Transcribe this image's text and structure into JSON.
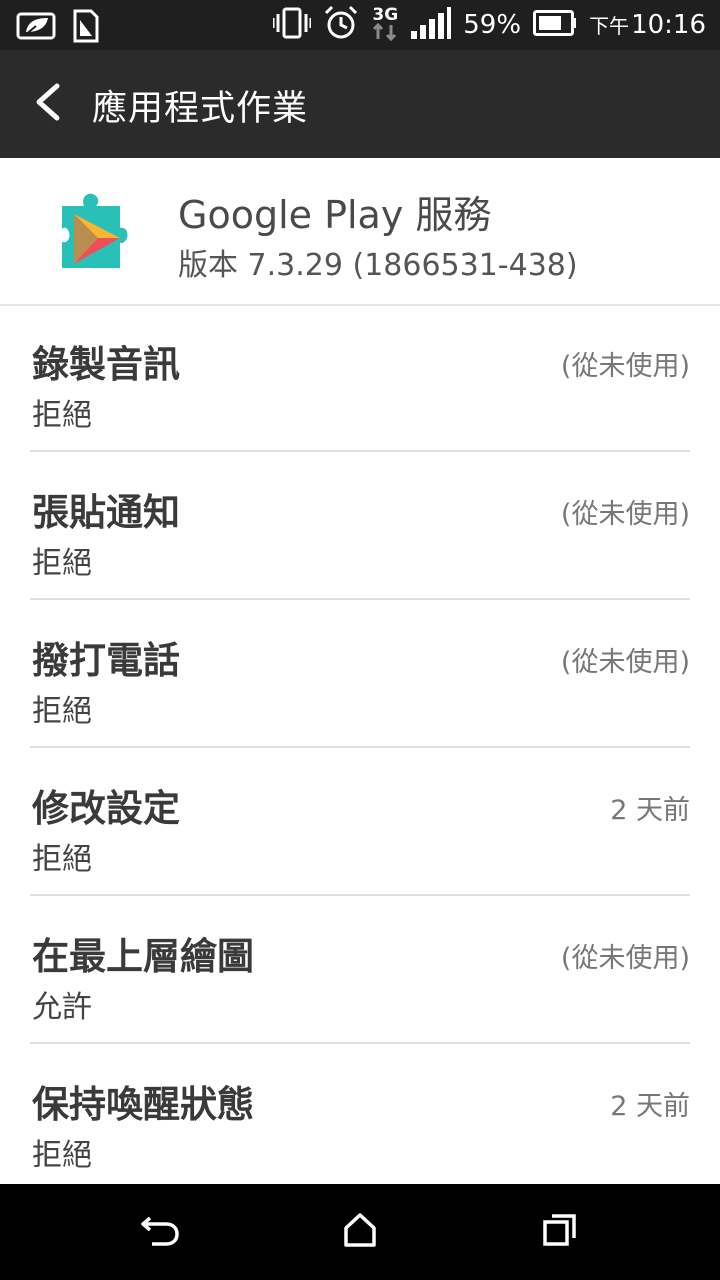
{
  "status_bar": {
    "battery_percent": "59%",
    "network": "3G",
    "time_prefix": "下午",
    "time": "10:16",
    "icons": [
      "leaf-icon",
      "sim-icon",
      "vibrate-icon",
      "alarm-icon",
      "network-3g-icon",
      "signal-icon",
      "battery-icon"
    ]
  },
  "action_bar": {
    "title": "應用程式作業",
    "back_icon": "chevron-left-icon"
  },
  "app": {
    "name": "Google Play 服務",
    "version": "版本 7.3.29 (1866531-438)",
    "icon": "google-play-services-icon"
  },
  "permissions": [
    {
      "title": "錄製音訊",
      "status": "拒絕",
      "last_used": "(從未使用)"
    },
    {
      "title": "張貼通知",
      "status": "拒絕",
      "last_used": "(從未使用)"
    },
    {
      "title": "撥打電話",
      "status": "拒絕",
      "last_used": "(從未使用)"
    },
    {
      "title": "修改設定",
      "status": "拒絕",
      "last_used": "2 天前"
    },
    {
      "title": "在最上層繪圖",
      "status": "允許",
      "last_used": "(從未使用)"
    },
    {
      "title": "保持喚醒狀態",
      "status": "拒絕",
      "last_used": "2 天前"
    }
  ],
  "nav_bar": {
    "icons": [
      "back-icon",
      "home-icon",
      "recent-apps-icon"
    ]
  },
  "colors": {
    "status_bar_bg": "#1f1f1f",
    "action_bar_bg": "#2b2b2b",
    "text_primary": "#3a3a3a",
    "text_secondary": "#777777"
  }
}
